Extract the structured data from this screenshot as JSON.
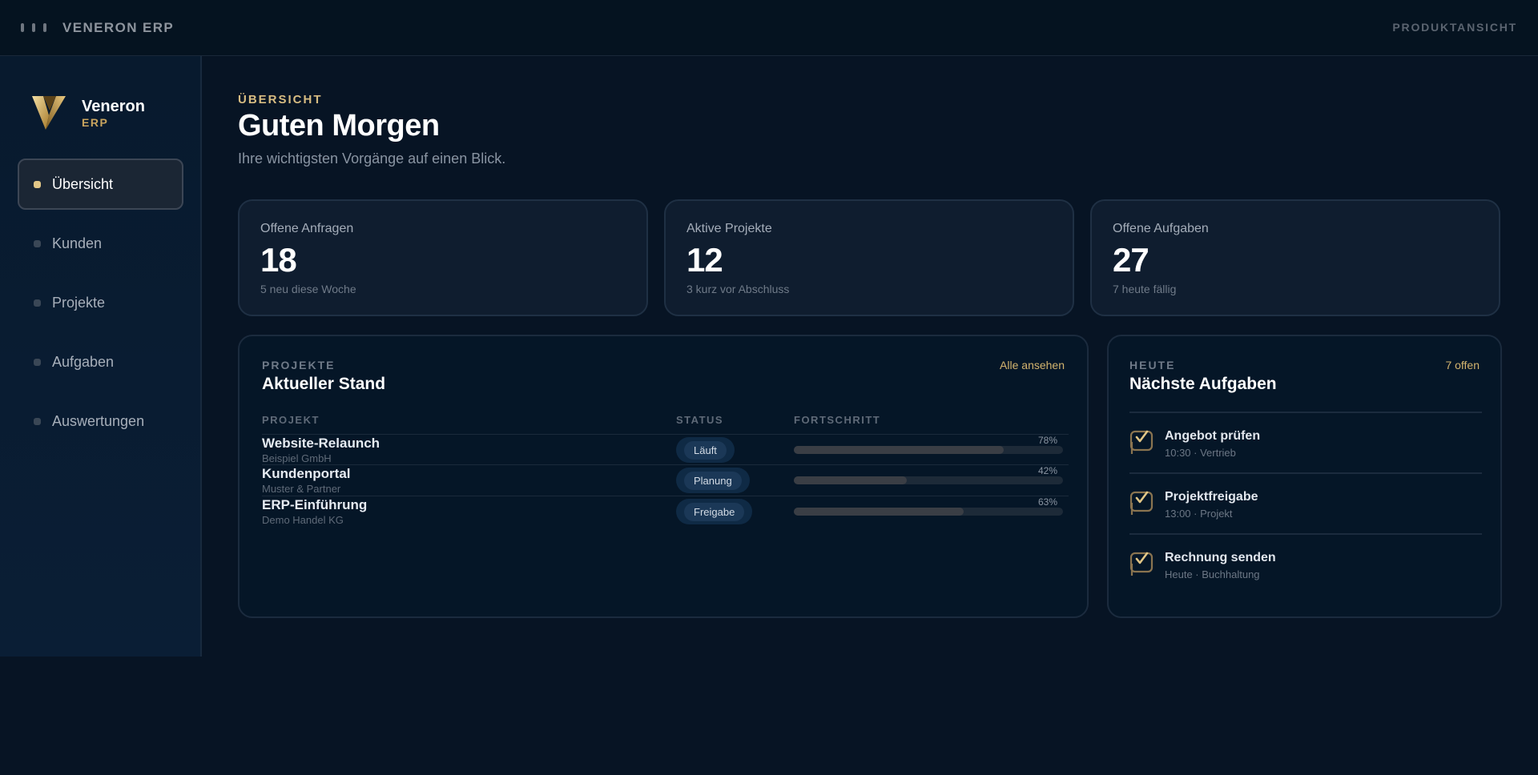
{
  "topbar": {
    "title": "VENERON ERP",
    "right_label": "PRODUKTANSICHT"
  },
  "brand": {
    "name": "Veneron",
    "sub": "ERP"
  },
  "sidebar": {
    "items": [
      {
        "label": "Übersicht",
        "active": true
      },
      {
        "label": "Kunden"
      },
      {
        "label": "Projekte"
      },
      {
        "label": "Aufgaben"
      },
      {
        "label": "Auswertungen"
      }
    ]
  },
  "header": {
    "eyebrow": "ÜBERSICHT",
    "title": "Guten Morgen",
    "subtitle": "Ihre wichtigsten Vorgänge auf einen Blick."
  },
  "stats": [
    {
      "label": "Offene Anfragen",
      "value": "18",
      "note": "5 neu diese Woche"
    },
    {
      "label": "Aktive Projekte",
      "value": "12",
      "note": "3 kurz vor Abschluss"
    },
    {
      "label": "Offene Aufgaben",
      "value": "27",
      "note": "7 heute fällig"
    }
  ],
  "projects": {
    "eyebrow": "PROJEKTE",
    "title": "Aktueller Stand",
    "link": "Alle ansehen",
    "columns": [
      "PROJEKT",
      "STATUS",
      "FORTSCHRITT"
    ],
    "rows": [
      {
        "name": "Website-Relaunch",
        "client": "Beispiel GmbH",
        "status": "Läuft",
        "progress": 78,
        "progress_label": "78%"
      },
      {
        "name": "Kundenportal",
        "client": "Muster & Partner",
        "status": "Planung",
        "progress": 42,
        "progress_label": "42%"
      },
      {
        "name": "ERP-Einführung",
        "client": "Demo Handel KG",
        "status": "Freigabe",
        "progress": 63,
        "progress_label": "63%"
      }
    ]
  },
  "today": {
    "eyebrow": "HEUTE",
    "title": "Nächste Aufgaben",
    "count": "7 offen",
    "tasks": [
      {
        "title": "Angebot prüfen",
        "meta": "10:30 · Vertrieb"
      },
      {
        "title": "Projektfreigabe",
        "meta": "13:00 · Projekt"
      },
      {
        "title": "Rechnung senden",
        "meta": "Heute · Buchhaltung"
      }
    ]
  },
  "colors": {
    "accent_gold": "#d8bd82",
    "background": "#071424",
    "card": "#0f1d2f",
    "badge": "#1b3857"
  },
  "icons": {
    "topbar": "menu-dots-icon",
    "brand": "veneron-logo-icon",
    "task": "task-check-icon"
  }
}
